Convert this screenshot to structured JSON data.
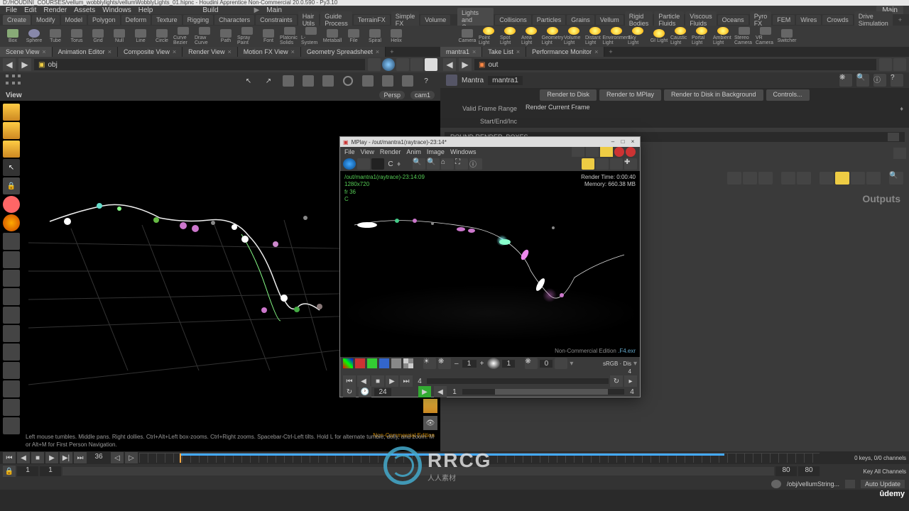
{
  "window": {
    "title": "D:/HOUDINI_COURSES/vellum_wobblylights/vellumWobblyLights_01.hipnc - Houdini Apprentice Non-Commercial 20.0.590 - Py3.10"
  },
  "menubar": {
    "file": "File",
    "edit": "Edit",
    "render": "Render",
    "assets": "Assets",
    "windows": "Windows",
    "help": "Help",
    "build": "Build",
    "main": "Main",
    "main_right": "Main"
  },
  "shelf_tabs_left": [
    {
      "label": "Create",
      "active": true
    },
    {
      "label": "Modify"
    },
    {
      "label": "Model"
    },
    {
      "label": "Polygon"
    },
    {
      "label": "Deform"
    },
    {
      "label": "Texture"
    },
    {
      "label": "Rigging"
    },
    {
      "label": "Characters"
    },
    {
      "label": "Constraints"
    },
    {
      "label": "Hair Utils"
    },
    {
      "label": "Guide Process"
    },
    {
      "label": "TerrainFX"
    },
    {
      "label": "Simple FX"
    },
    {
      "label": "Volume"
    }
  ],
  "shelf_tabs_right": [
    {
      "label": "Lights and Cameras",
      "active": true
    },
    {
      "label": "Collisions"
    },
    {
      "label": "Particles"
    },
    {
      "label": "Grains"
    },
    {
      "label": "Vellum"
    },
    {
      "label": "Rigid Bodies"
    },
    {
      "label": "Particle Fluids"
    },
    {
      "label": "Viscous Fluids"
    },
    {
      "label": "Oceans"
    },
    {
      "label": "Pyro FX"
    },
    {
      "label": "FEM"
    },
    {
      "label": "Wires"
    },
    {
      "label": "Crowds"
    },
    {
      "label": "Drive Simulation"
    }
  ],
  "shelf_tools_left": [
    {
      "label": "Box"
    },
    {
      "label": "Sphere"
    },
    {
      "label": "Tube"
    },
    {
      "label": "Torus"
    },
    {
      "label": "Grid"
    },
    {
      "label": "Null"
    },
    {
      "label": "Line"
    },
    {
      "label": "Circle"
    },
    {
      "label": "Curve Bezier"
    },
    {
      "label": "Draw Curve"
    },
    {
      "label": "Path"
    },
    {
      "label": "Spray Paint"
    },
    {
      "label": "Font"
    },
    {
      "label": "Platonic Solids"
    },
    {
      "label": "L-System"
    },
    {
      "label": "Metaball"
    },
    {
      "label": "File"
    },
    {
      "label": "Spiral"
    },
    {
      "label": "Helix"
    }
  ],
  "shelf_tools_right": [
    {
      "label": "Camera"
    },
    {
      "label": "Point Light"
    },
    {
      "label": "Spot Light"
    },
    {
      "label": "Area Light"
    },
    {
      "label": "Geometry Light"
    },
    {
      "label": "Volume Light"
    },
    {
      "label": "Distant Light"
    },
    {
      "label": "Environment Light"
    },
    {
      "label": "Sky Light"
    },
    {
      "label": "GI Light"
    },
    {
      "label": "Caustic Light"
    },
    {
      "label": "Portal Light"
    },
    {
      "label": "Ambient Light"
    },
    {
      "label": "Stereo Camera"
    },
    {
      "label": "VR Camera"
    },
    {
      "label": "Switcher"
    }
  ],
  "pane_tabs_left": [
    {
      "label": "Scene View",
      "active": true
    },
    {
      "label": "Animation Editor"
    },
    {
      "label": "Composite View"
    },
    {
      "label": "Render View"
    },
    {
      "label": "Motion FX View"
    },
    {
      "label": "Geometry Spreadsheet"
    }
  ],
  "pane_tabs_right": [
    {
      "label": "mantra1",
      "active": true
    },
    {
      "label": "Take List"
    },
    {
      "label": "Performance Monitor"
    }
  ],
  "nav": {
    "left_path": "obj",
    "right_path": "out"
  },
  "viewport": {
    "label": "View",
    "persp": "Persp",
    "cam": "cam1",
    "help_text": "Left mouse tumbles. Middle pans. Right dollies. Ctrl+Alt+Left box-zooms. Ctrl+Right zooms. Spacebar-Ctrl-Left tilts. Hold L for alternate tumble, dolly, and zoom. M or Alt+M for First Person Navigation.",
    "nce": "Non-Commercial Edition"
  },
  "parms": {
    "type": "Mantra",
    "name": "mantra1",
    "btn_disk": "Render to Disk",
    "btn_mplay": "Render to MPlay",
    "btn_bg": "Render to Disk in Background",
    "btn_controls": "Controls...",
    "vframe_label": "Valid Frame Range",
    "vframe_value": "Render Current Frame",
    "start_label": "Start/End/Inc"
  },
  "mplay": {
    "title": "MPlay - /out/mantra1(raytrace)-23:14*",
    "menu": {
      "file": "File",
      "view": "View",
      "render": "Render",
      "anim": "Anim",
      "image": "Image",
      "windows": "Windows"
    },
    "info_path": "/out/mantra1(raytrace)-23:14:09",
    "info_res": "1280x720",
    "info_frame": "fr 36",
    "info_c": "C",
    "rtime": "Render Time: 0:00:40",
    "mem": "Memory:    660.38 MB",
    "nce": "Non-Commercial Edition",
    "exr": ".F4.exr",
    "colorspace": "sRGB · Dis",
    "gamma1": "1",
    "gamma2": "1",
    "zero": "0",
    "frame": "4",
    "range_start": "1",
    "range_end": "4",
    "fps": "24",
    "tick4": "4"
  },
  "network": {
    "outputs_label": "Outputs",
    "nce_wm": "-Commercial Edition",
    "network_str": "ROUND RENDER_BOXES"
  },
  "timeline": {
    "frame": "36",
    "start": "1",
    "end": "80",
    "max": "80",
    "keys": "0 keys, 0/0 channels",
    "chans": "Key All Channels"
  },
  "status": {
    "path": "/obj/vellumString...",
    "auto": "Auto Update"
  },
  "watermark": {
    "big": "RRCG",
    "small": "人人素材"
  },
  "udemy": "ûdemy"
}
